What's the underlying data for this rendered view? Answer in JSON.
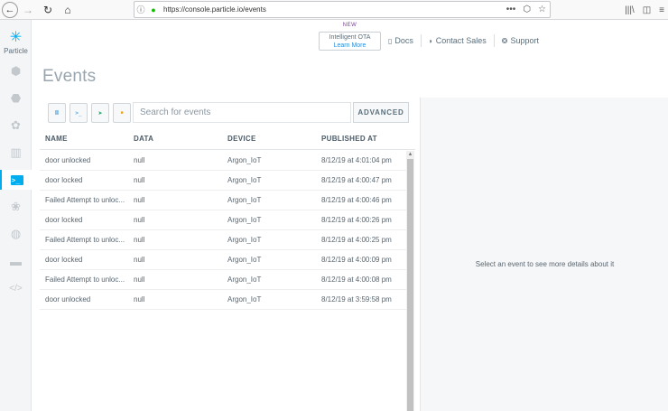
{
  "browser": {
    "back_icon": "back-arrow-icon",
    "url": "https://console.particle.io/events",
    "url_glyph": "←",
    "fwd_glyph": "→",
    "reload_glyph": "↻",
    "home_glyph": "⌂",
    "info_glyph": "ⓘ",
    "lock_glyph": "🔒",
    "more_glyph": "•••",
    "pocket_glyph": "⬡",
    "star_glyph": "☆",
    "library_glyph": "|||\\",
    "sidebar_glyph": "◫",
    "menu_glyph": "≡"
  },
  "rail": {
    "logo_glyph": "✳",
    "logo_text": "Particle",
    "items": [
      {
        "name": "rail-devices-icon",
        "glyph": "⬢"
      },
      {
        "name": "rail-products-icon",
        "glyph": "⬣"
      },
      {
        "name": "rail-networks-icon",
        "glyph": "✿"
      },
      {
        "name": "rail-sims-icon",
        "glyph": "▥"
      },
      {
        "name": "rail-events-icon",
        "glyph": ">_"
      },
      {
        "name": "rail-mesh-icon",
        "glyph": "❀"
      },
      {
        "name": "rail-auth-icon",
        "glyph": "◍"
      },
      {
        "name": "rail-billing-icon",
        "glyph": "▬"
      },
      {
        "name": "rail-integrations-icon",
        "glyph": "</>"
      }
    ]
  },
  "top": {
    "new_badge": "NEW",
    "ota_line1": "Intelligent OTA",
    "ota_line2": "Learn More",
    "docs": "Docs",
    "docs_glyph": "▯",
    "contact": "Contact Sales",
    "contact_glyph": "◗",
    "support": "Support",
    "support_glyph": "❂"
  },
  "page": {
    "title": "Events"
  },
  "toolbar": {
    "pause_glyph": "II",
    "terminal_glyph": ">_",
    "locate_glyph": "➤",
    "lock_glyph": "■",
    "search_placeholder": "Search for events",
    "advanced_label": "ADVANCED"
  },
  "table": {
    "headers": {
      "name": "NAME",
      "data": "DATA",
      "device": "DEVICE",
      "published": "PUBLISHED AT"
    },
    "rows": [
      {
        "name": "door unlocked",
        "data": "null",
        "device": "Argon_IoT",
        "published": "8/12/19 at 4:01:04 pm"
      },
      {
        "name": "door locked",
        "data": "null",
        "device": "Argon_IoT",
        "published": "8/12/19 at 4:00:47 pm"
      },
      {
        "name": "Failed Attempt to unloc...",
        "data": "null",
        "device": "Argon_IoT",
        "published": "8/12/19 at 4:00:46 pm"
      },
      {
        "name": "door locked",
        "data": "null",
        "device": "Argon_IoT",
        "published": "8/12/19 at 4:00:26 pm"
      },
      {
        "name": "Failed Attempt to unloc...",
        "data": "null",
        "device": "Argon_IoT",
        "published": "8/12/19 at 4:00:25 pm"
      },
      {
        "name": "door locked",
        "data": "null",
        "device": "Argon_IoT",
        "published": "8/12/19 at 4:00:09 pm"
      },
      {
        "name": "Failed Attempt to unloc...",
        "data": "null",
        "device": "Argon_IoT",
        "published": "8/12/19 at 4:00:08 pm"
      },
      {
        "name": "door unlocked",
        "data": "null",
        "device": "Argon_IoT",
        "published": "8/12/19 at 3:59:58 pm"
      }
    ]
  },
  "details": {
    "empty_message": "Select an event to see more details about it"
  }
}
